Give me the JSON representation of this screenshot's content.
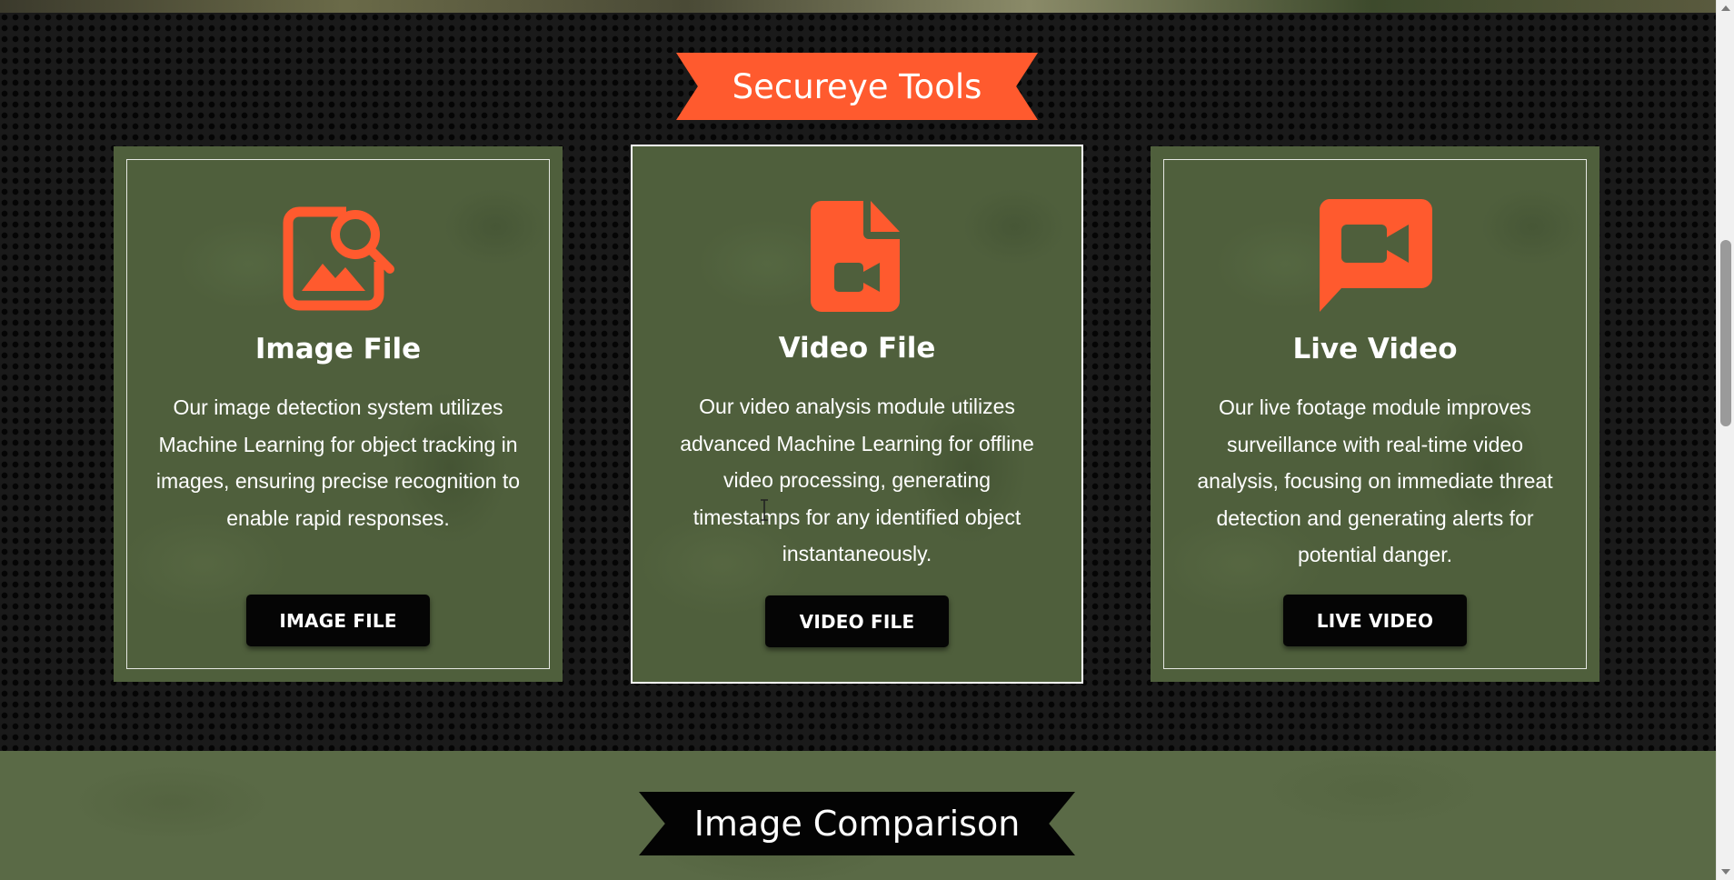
{
  "sections": {
    "tools_title": "Secureye Tools",
    "comparison_title": "Image Comparison"
  },
  "cards": [
    {
      "icon": "image-search-icon",
      "title": "Image File",
      "description": "Our image detection system utilizes Machine Learning for object tracking in images, ensuring precise recognition to enable rapid responses.",
      "button": "IMAGE FILE"
    },
    {
      "icon": "video-file-icon",
      "title": "Video File",
      "description": "Our video analysis module utilizes advanced Machine Learning for offline video processing, generating timestamps for any identified object instantaneously.",
      "button": "VIDEO FILE"
    },
    {
      "icon": "live-video-icon",
      "title": "Live Video",
      "description": "Our live footage module improves surveillance with real-time video analysis, focusing on immediate threat detection and generating alerts for potential danger.",
      "button": "LIVE VIDEO"
    }
  ],
  "colors": {
    "accent": "#ff5a2e",
    "card_bg": "#4f5f3c",
    "button_bg": "#050505"
  }
}
